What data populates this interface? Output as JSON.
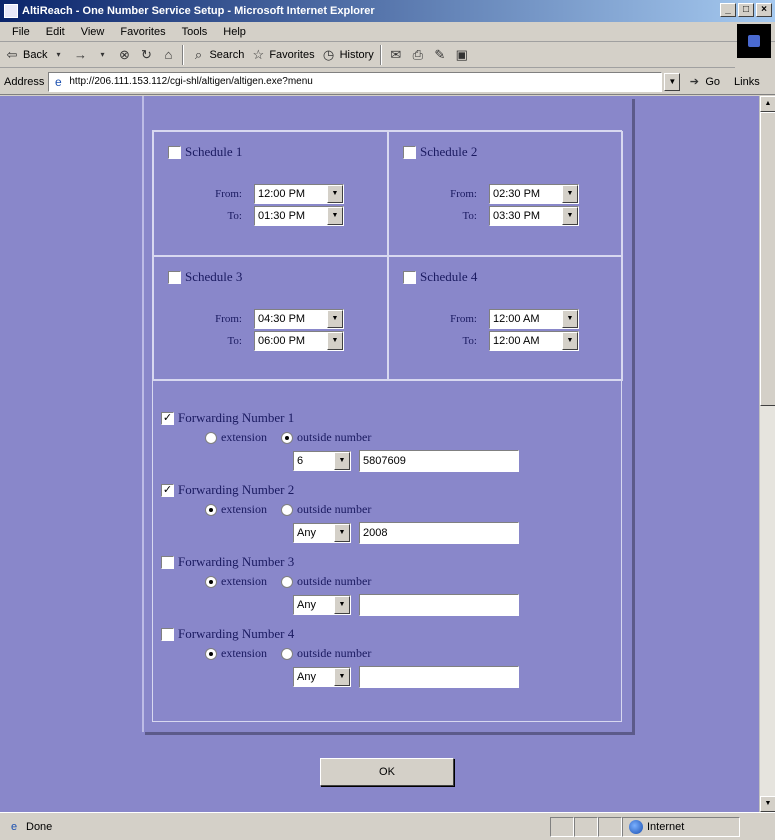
{
  "window": {
    "title": "AltiReach - One Number Service Setup - Microsoft Internet Explorer",
    "controls": [
      "_",
      "□",
      "×"
    ]
  },
  "menu": [
    "File",
    "Edit",
    "View",
    "Favorites",
    "Tools",
    "Help"
  ],
  "toolbar": {
    "back": "Back",
    "search": "Search",
    "favorites": "Favorites",
    "history": "History"
  },
  "address": {
    "label": "Address",
    "url": "http://206.111.153.112/cgi-shl/altigen/altigen.exe?menu",
    "go": "Go",
    "links": "Links"
  },
  "schedules": [
    {
      "label": "Schedule 1",
      "checked": false,
      "from": "12:00 PM",
      "to": "01:30 PM"
    },
    {
      "label": "Schedule 2",
      "checked": false,
      "from": "02:30 PM",
      "to": "03:30 PM"
    },
    {
      "label": "Schedule 3",
      "checked": false,
      "from": "04:30 PM",
      "to": "06:00 PM"
    },
    {
      "label": "Schedule 4",
      "checked": false,
      "from": "12:00 AM",
      "to": "12:00 AM"
    }
  ],
  "labels": {
    "from": "From:",
    "to": "To:",
    "extension": "extension",
    "outside": "outside number"
  },
  "forwarding": [
    {
      "label": "Forwarding Number 1",
      "checked": true,
      "mode": "outside",
      "prefix": "6",
      "number": "5807609"
    },
    {
      "label": "Forwarding Number 2",
      "checked": true,
      "mode": "extension",
      "prefix": "Any",
      "number": "2008"
    },
    {
      "label": "Forwarding Number 3",
      "checked": false,
      "mode": "extension",
      "prefix": "Any",
      "number": ""
    },
    {
      "label": "Forwarding Number 4",
      "checked": false,
      "mode": "extension",
      "prefix": "Any",
      "number": ""
    }
  ],
  "ok_label": "OK",
  "status": {
    "text": "Done",
    "zone": "Internet"
  },
  "colors": {
    "page_bg": "#8987ca",
    "title_start": "#0a246a",
    "title_end": "#a6caf0"
  }
}
